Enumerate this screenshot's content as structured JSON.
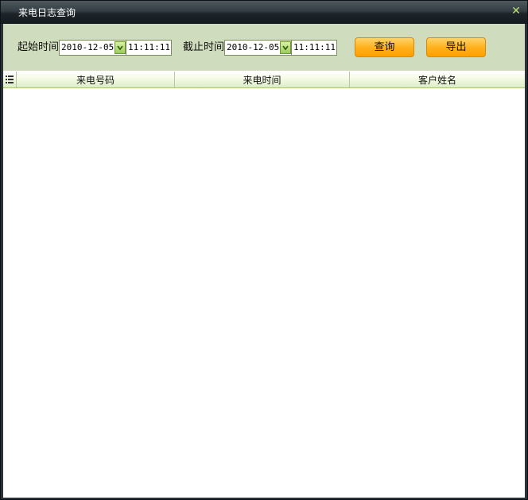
{
  "window": {
    "title": "来电日志查询",
    "close_icon": "close-icon"
  },
  "toolbar": {
    "start_label": "起始时间",
    "start_date": "2010-12-05",
    "start_time": "11:11:11",
    "end_label": "截止时间",
    "end_date": "2010-12-05",
    "end_time": "11:11:11",
    "query_button": "查询",
    "export_button": "导出"
  },
  "grid": {
    "columns": [
      "来电号码",
      "来电时间",
      "客户姓名"
    ],
    "rows": []
  },
  "colors": {
    "titlebar": "#1d2529",
    "toolbar_bg": "#cfdcbd",
    "button_accent": "#ffb21f",
    "close_icon": "#b9e06b",
    "header_bg": "#dceec0"
  }
}
